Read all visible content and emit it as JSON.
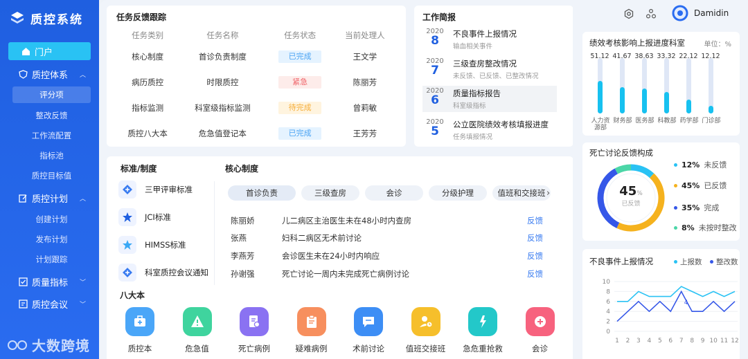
{
  "app": {
    "title": "质控系统",
    "watermark": "大数跨境"
  },
  "sidebar": {
    "home": "门户",
    "groups": [
      {
        "label": "质控体系",
        "items": [
          "评分项",
          "整改反馈",
          "工作流配置",
          "指标池",
          "质控目标值"
        ]
      },
      {
        "label": "质控计划",
        "items": [
          "创建计划",
          "发布计划",
          "计划跟踪"
        ]
      },
      {
        "label": "质量指标",
        "items": []
      },
      {
        "label": "质控会议",
        "items": []
      }
    ]
  },
  "task_feedback": {
    "title": "任务反馈跟踪",
    "headers": [
      "任务类别",
      "任务名称",
      "任务状态",
      "当前处理人"
    ],
    "rows": [
      {
        "cat": "核心制度",
        "name": "首诊负责制度",
        "status": "已完成",
        "status_type": "done",
        "owner": "王文学"
      },
      {
        "cat": "病历质控",
        "name": "时限质控",
        "status": "紧急",
        "status_type": "urgent",
        "owner": "陈丽芳"
      },
      {
        "cat": "指标监测",
        "name": "科室级指标监测",
        "status": "待完成",
        "status_type": "pending",
        "owner": "曾莉敏"
      },
      {
        "cat": "质控八大本",
        "name": "危急值登记本",
        "status": "已完成",
        "status_type": "done",
        "owner": "王芳芳"
      }
    ]
  },
  "work_brief": {
    "title": "工作简报",
    "items": [
      {
        "year": "2020",
        "day": "8",
        "title": "不良事件上报情况",
        "sub": "输血相关事件"
      },
      {
        "year": "2020",
        "day": "7",
        "title": "三级查房整改情况",
        "sub": "未反馈、已反馈、已整改情况"
      },
      {
        "year": "2020",
        "day": "6",
        "title": "质量指标报告",
        "sub": "科室级指标"
      },
      {
        "year": "2020",
        "day": "5",
        "title": "公立医院绩效考核填报进度",
        "sub": "任务填报情况"
      }
    ]
  },
  "standards": {
    "title": "标准/制度",
    "items": [
      "三甲评审标准",
      "JCI标准",
      "HIMSS标准",
      "科室质控会议通知"
    ]
  },
  "core_system": {
    "title": "核心制度",
    "tabs": [
      "首诊负责",
      "三级查房",
      "会诊",
      "分级护理",
      "值班和交接班"
    ],
    "rows": [
      {
        "name": "陈丽娇",
        "content": "儿二病区主治医生未在48小时内查房",
        "action": "反馈"
      },
      {
        "name": "张燕",
        "content": "妇科二病区无术前讨论",
        "action": "反馈"
      },
      {
        "name": "李燕芳",
        "content": "会诊医生未在24小时内响应",
        "action": "反馈"
      },
      {
        "name": "孙谢强",
        "content": "死亡讨论一周内未完成死亡病例讨论",
        "action": "反馈"
      }
    ]
  },
  "eight_books": {
    "title": "八大本",
    "items": [
      {
        "label": "质控本",
        "color": "#4aa6f8",
        "icon": "medical-kit-icon"
      },
      {
        "label": "危急值",
        "color": "#3fd49e",
        "icon": "warning-icon"
      },
      {
        "label": "死亡病例",
        "color": "#8a72f2",
        "icon": "document-edit-icon"
      },
      {
        "label": "疑难病例",
        "color": "#f78f5e",
        "icon": "clipboard-icon"
      },
      {
        "label": "术前讨论",
        "color": "#3d8ef5",
        "icon": "chat-icon"
      },
      {
        "label": "值班交接班",
        "color": "#f6bf2b",
        "icon": "clock-user-icon"
      },
      {
        "label": "急危重抢救",
        "color": "#23c8c9",
        "icon": "emergency-icon"
      },
      {
        "label": "会诊",
        "color": "#f7627e",
        "icon": "plus-icon"
      }
    ]
  },
  "header": {
    "user": "Damidin"
  },
  "perf_chart": {
    "title": "绩效考核影响上报进度科室",
    "unit": "单位：%",
    "chart_data": {
      "type": "bar",
      "categories": [
        "人力资源部",
        "财务部",
        "医务部",
        "科教部",
        "药学部",
        "门诊部"
      ],
      "values": [
        51.12,
        41.67,
        38.63,
        33.32,
        22.12,
        12.12
      ],
      "value_labels": [
        "51.12",
        "41.67",
        "38.63",
        "33.32",
        "22.12",
        "12.12"
      ],
      "ylim": [
        0,
        100
      ]
    }
  },
  "death_chart": {
    "title": "死亡讨论反馈构成",
    "center_value": "45",
    "center_unit": "%",
    "center_label": "已反馈",
    "chart_data": {
      "type": "pie",
      "categories": [
        "未反馈",
        "已反馈",
        "完成",
        "未按时整改"
      ],
      "values": [
        12,
        45,
        35,
        8
      ],
      "value_labels": [
        "12%",
        "45%",
        "35%",
        "8%"
      ],
      "colors": [
        "#29c2f4",
        "#f5b21e",
        "#3557e8",
        "#4bd6a7"
      ]
    }
  },
  "adverse_chart": {
    "title": "不良事件上报情况",
    "chart_data": {
      "type": "line",
      "x": [
        1,
        2,
        3,
        4,
        5,
        6,
        7,
        8,
        9,
        10,
        11,
        12
      ],
      "x_labels": [
        "1",
        "2",
        "3",
        "4",
        "5",
        "6",
        "7",
        "8",
        "9",
        "10",
        "11",
        "12"
      ],
      "series": [
        {
          "name": "上报数",
          "color": "#29c2f4",
          "values": [
            6,
            6,
            8,
            7,
            7,
            7,
            9,
            8,
            7,
            8,
            7,
            8
          ]
        },
        {
          "name": "整改数",
          "color": "#3557e8",
          "values": [
            2,
            4,
            6,
            4,
            6,
            4,
            8,
            4,
            4,
            6,
            4,
            6
          ]
        }
      ],
      "ylim": [
        0,
        10
      ],
      "y_ticks": [
        "0",
        "2",
        "4",
        "6",
        "8",
        "10"
      ],
      "annotation": "4"
    }
  }
}
